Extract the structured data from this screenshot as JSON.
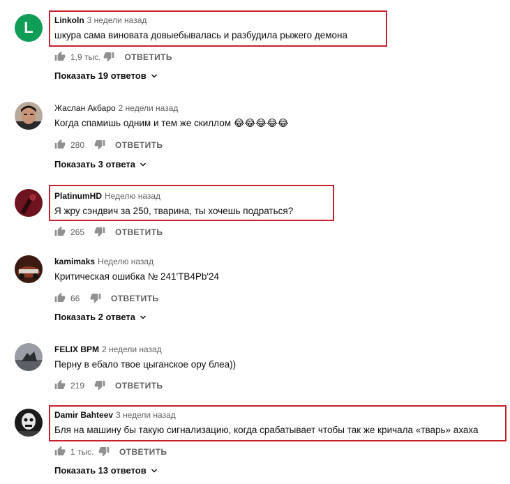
{
  "comments": [
    {
      "avatar_letter": "L",
      "avatar_color": "#0f9d58",
      "author": "Linkoln",
      "time": "3 недели назад",
      "text": "шкура сама виновата довыебывалась и разбудила рыжего демона",
      "likes": "1,9 тыс.",
      "reply_label": "ОТВЕТИТЬ",
      "replies_label": "Показать 19 ответов",
      "highlighted": true
    },
    {
      "author": "Жаслан Акбаро",
      "time": "2 недели назад",
      "text": "Когда спамишь одним и тем же скиллом 😂😂😂😂😂",
      "likes": "280",
      "reply_label": "ОТВЕТИТЬ",
      "replies_label": "Показать 3 ответа",
      "highlighted": false
    },
    {
      "author": "PlatinumHD",
      "time": "Неделю назад",
      "text": "Я жру сэндвич за 250, тварина, ты хочешь подраться?",
      "likes": "265",
      "reply_label": "ОТВЕТИТЬ",
      "highlighted": true
    },
    {
      "author": "kamimaks",
      "time": "Неделю назад",
      "text": "Критическая ошибка № 241'ТВ4Рb'24",
      "likes": "66",
      "reply_label": "ОТВЕТИТЬ",
      "replies_label": "Показать 2 ответа",
      "highlighted": false
    },
    {
      "author": "FELIX BPM",
      "time": "2 недели назад",
      "text": "Перну в ебало твое цыганское ору блеа))",
      "likes": "219",
      "reply_label": "ОТВЕТИТЬ",
      "highlighted": false
    },
    {
      "author": "Damir Bahteev",
      "time": "3 недели назад",
      "text": "Бля на машину бы такую сигнализацию, когда срабатывает чтобы так же кричала «тварь» ахаха",
      "likes": "1 тыс.",
      "reply_label": "ОТВЕТИТЬ",
      "replies_label": "Показать 13 ответов",
      "highlighted": true
    }
  ],
  "colors": {
    "highlight_border": "#c8202a",
    "meta_gray": "#606060",
    "text": "#0d0d0d"
  }
}
